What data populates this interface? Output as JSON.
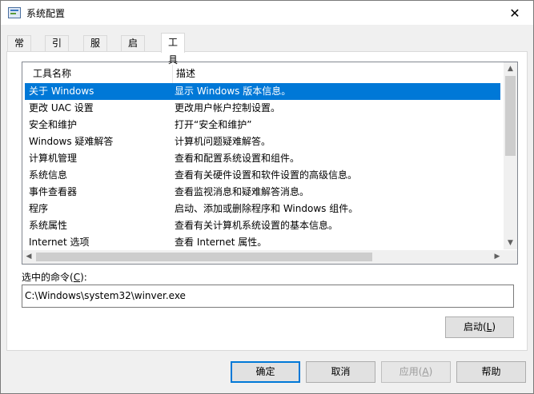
{
  "window": {
    "title": "系统配置",
    "close_glyph": "✕"
  },
  "tabs": [
    {
      "label": "常规"
    },
    {
      "label": "引导"
    },
    {
      "label": "服务"
    },
    {
      "label": "启动"
    },
    {
      "label": "工具",
      "active": true
    }
  ],
  "tools_list": {
    "columns": [
      "工具名称",
      "描述"
    ],
    "rows": [
      {
        "name": "关于 Windows",
        "desc": "显示 Windows 版本信息。",
        "selected": true
      },
      {
        "name": "更改 UAC 设置",
        "desc": "更改用户帐户控制设置。"
      },
      {
        "name": "安全和维护",
        "desc": "打开“安全和维护”"
      },
      {
        "name": "Windows 疑难解答",
        "desc": "计算机问题疑难解答。"
      },
      {
        "name": "计算机管理",
        "desc": "查看和配置系统设置和组件。"
      },
      {
        "name": "系统信息",
        "desc": "查看有关硬件设置和软件设置的高级信息。"
      },
      {
        "name": "事件查看器",
        "desc": "查看监视消息和疑难解答消息。"
      },
      {
        "name": "程序",
        "desc": "启动、添加或删除程序和 Windows 组件。"
      },
      {
        "name": "系统属性",
        "desc": "查看有关计算机系统设置的基本信息。"
      },
      {
        "name": "Internet 选项",
        "desc": "查看 Internet 属性。"
      }
    ]
  },
  "selected_command": {
    "label_prefix": "选中的命令(",
    "label_key": "C",
    "label_suffix": "):",
    "value": "C:\\Windows\\system32\\winver.exe"
  },
  "buttons": {
    "launch": {
      "prefix": "启动(",
      "key": "L",
      "suffix": ")"
    },
    "ok": "确定",
    "cancel": "取消",
    "apply": {
      "prefix": "应用(",
      "key": "A",
      "suffix": ")"
    },
    "help": "帮助"
  },
  "colors": {
    "selection": "#0078d7",
    "window_bg": "#f0f0f0"
  },
  "icons": {
    "app": "system-config-icon",
    "close": "close-icon",
    "scroll_up": "▲",
    "scroll_down": "▼",
    "scroll_left": "◀",
    "scroll_right": "▶"
  }
}
